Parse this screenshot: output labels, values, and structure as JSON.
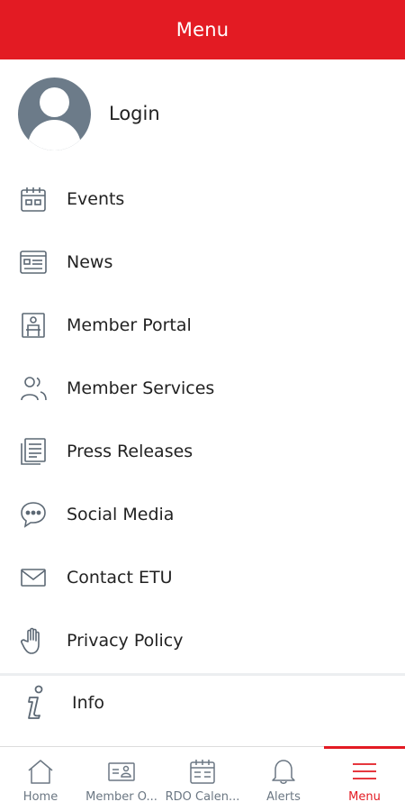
{
  "header": {
    "title": "Menu"
  },
  "profile": {
    "login_label": "Login"
  },
  "menu": {
    "items": [
      {
        "label": "Events",
        "icon": "calendar-icon"
      },
      {
        "label": "News",
        "icon": "newspaper-icon"
      },
      {
        "label": "Member Portal",
        "icon": "member-portal-icon"
      },
      {
        "label": "Member Services",
        "icon": "people-icon"
      },
      {
        "label": "Press Releases",
        "icon": "document-icon"
      },
      {
        "label": "Social Media",
        "icon": "chat-bubble-icon"
      },
      {
        "label": "Contact ETU",
        "icon": "envelope-icon"
      },
      {
        "label": "Privacy Policy",
        "icon": "hand-icon"
      }
    ],
    "info": {
      "label": "Info",
      "icon": "info-icon"
    }
  },
  "tabbar": {
    "tabs": [
      {
        "label": "Home",
        "icon": "home-icon",
        "active": false
      },
      {
        "label": "Member O...",
        "icon": "member-card-icon",
        "active": false
      },
      {
        "label": "RDO Calen...",
        "icon": "calendar-icon",
        "active": false
      },
      {
        "label": "Alerts",
        "icon": "bell-icon",
        "active": false
      },
      {
        "label": "Menu",
        "icon": "hamburger-icon",
        "active": true
      }
    ]
  },
  "colors": {
    "brand_red": "#e31b23",
    "icon_gray": "#6b7783",
    "avatar_gray": "#6c7b89"
  }
}
